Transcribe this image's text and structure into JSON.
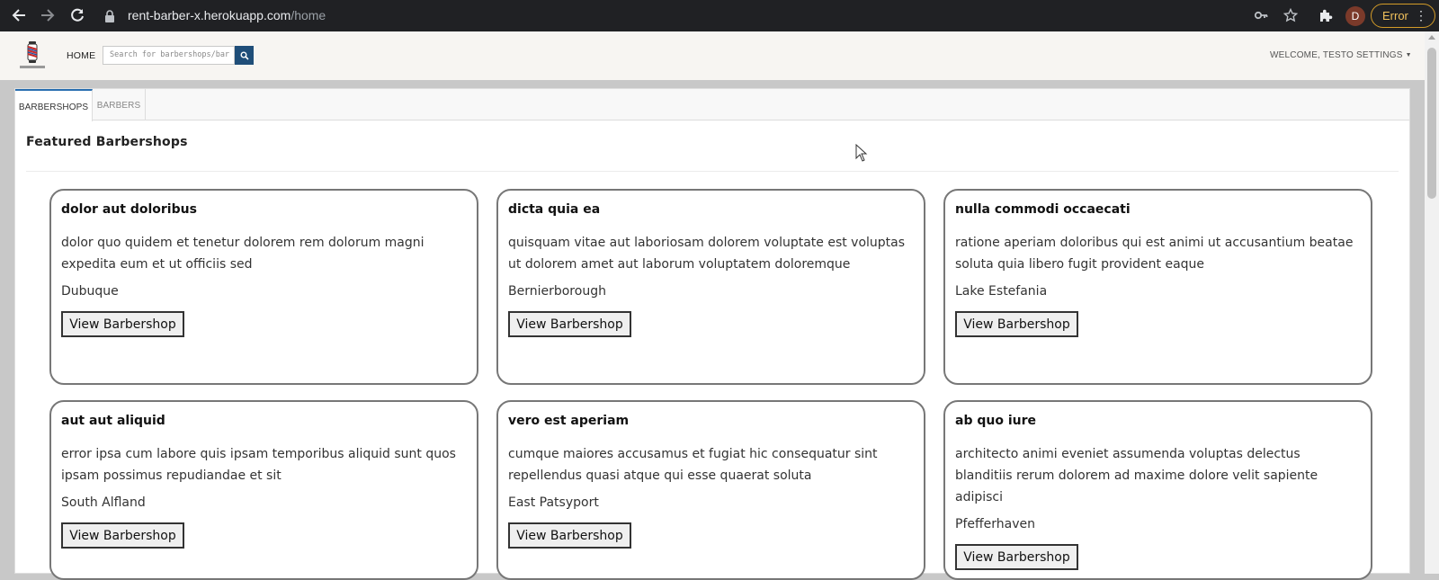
{
  "browser": {
    "url_host": "rent-barber-x.herokuapp.com",
    "url_path": "/home",
    "profile_initial": "D",
    "error_label": "Error"
  },
  "navbar": {
    "home_label": "HOME",
    "search_placeholder": "Search for barbershops/bar",
    "welcome_text": "WELCOME, TESTO",
    "settings_label": "SETTINGS"
  },
  "tabs": [
    {
      "label": "BARBERSHOPS",
      "active": true
    },
    {
      "label": "BARBERS",
      "active": false
    }
  ],
  "section_title": "Featured Barbershops",
  "cards": [
    {
      "title": "dolor aut doloribus",
      "description": "dolor quo quidem et tenetur dolorem rem dolorum magni expedita eum et ut officiis sed",
      "city": "Dubuque",
      "button": "View Barbershop"
    },
    {
      "title": "dicta quia ea",
      "description": "quisquam vitae aut laboriosam dolorem voluptate est voluptas ut dolorem amet aut laborum voluptatem doloremque",
      "city": "Bernierborough",
      "button": "View Barbershop"
    },
    {
      "title": "nulla commodi occaecati",
      "description": "ratione aperiam doloribus qui est animi ut accusantium beatae soluta quia libero fugit provident eaque",
      "city": "Lake Estefania",
      "button": "View Barbershop"
    },
    {
      "title": "aut aut aliquid",
      "description": "error ipsa cum labore quis ipsam temporibus aliquid sunt quos ipsam possimus repudiandae et sit",
      "city": "South Alfland",
      "button": "View Barbershop"
    },
    {
      "title": "vero est aperiam",
      "description": "cumque maiores accusamus et fugiat hic consequatur sint repellendus quasi atque qui esse quaerat soluta",
      "city": "East Patsyport",
      "button": "View Barbershop"
    },
    {
      "title": "ab quo iure",
      "description": "architecto animi eveniet assumenda voluptas delectus blanditiis rerum dolorem ad maxime dolore velit sapiente adipisci",
      "city": "Pfefferhaven",
      "button": "View Barbershop"
    }
  ],
  "colors": {
    "chrome_bg": "#202124",
    "navbar_bg": "#f7f5f2",
    "search_button": "#1f4e79",
    "active_tab_accent": "#2a6fb0",
    "error_accent": "#f1c15c"
  },
  "icons": [
    "back-icon",
    "forward-icon",
    "reload-icon",
    "lock-icon",
    "key-icon",
    "star-icon",
    "extensions-icon",
    "search-icon",
    "barber-pole-logo",
    "cursor-icon"
  ]
}
